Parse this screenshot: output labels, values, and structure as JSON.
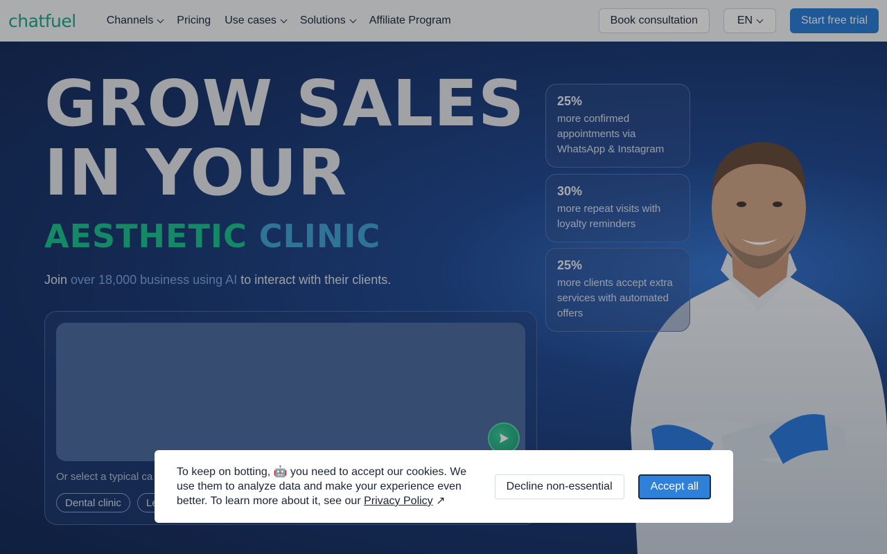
{
  "header": {
    "logo": "chatfuel",
    "nav": [
      {
        "label": "Channels",
        "dropdown": true
      },
      {
        "label": "Pricing",
        "dropdown": false
      },
      {
        "label": "Use cases",
        "dropdown": true
      },
      {
        "label": "Solutions",
        "dropdown": true
      },
      {
        "label": "Affiliate Program",
        "dropdown": false
      }
    ],
    "consult_label": "Book consultation",
    "lang_label": "EN",
    "trial_label": "Start free trial"
  },
  "hero": {
    "headline_line1": "GROW SALES",
    "headline_line2": "IN YOUR",
    "sub_word1": "AESTHETIC",
    "sub_word2": "CLINIC",
    "join_prefix": "Join ",
    "join_highlight": "over 18,000 business using AI",
    "join_suffix": " to interact with their clients.",
    "select_label": "Or select a typical ca",
    "chips": [
      "Dental clinic",
      "Le"
    ]
  },
  "stats": [
    {
      "num": "25%",
      "text": "more confirmed appointments via WhatsApp & Instagram"
    },
    {
      "num": "30%",
      "text": "more repeat visits with loyalty reminders"
    },
    {
      "num": "25%",
      "text": "more clients accept extra services with automated offers"
    }
  ],
  "cookie": {
    "text_before": "To keep on botting, 🤖 you need to accept our cookies. We use them to analyze data and make your experience even better. To learn more about it, see our ",
    "link": "Privacy Policy",
    "link_arrow": "↗",
    "decline_label": "Decline non-essential",
    "accept_label": "Accept all"
  },
  "colors": {
    "brand_green": "#1fa98f",
    "primary_blue": "#2f80d9",
    "hero_bg": "#1d3a74"
  }
}
